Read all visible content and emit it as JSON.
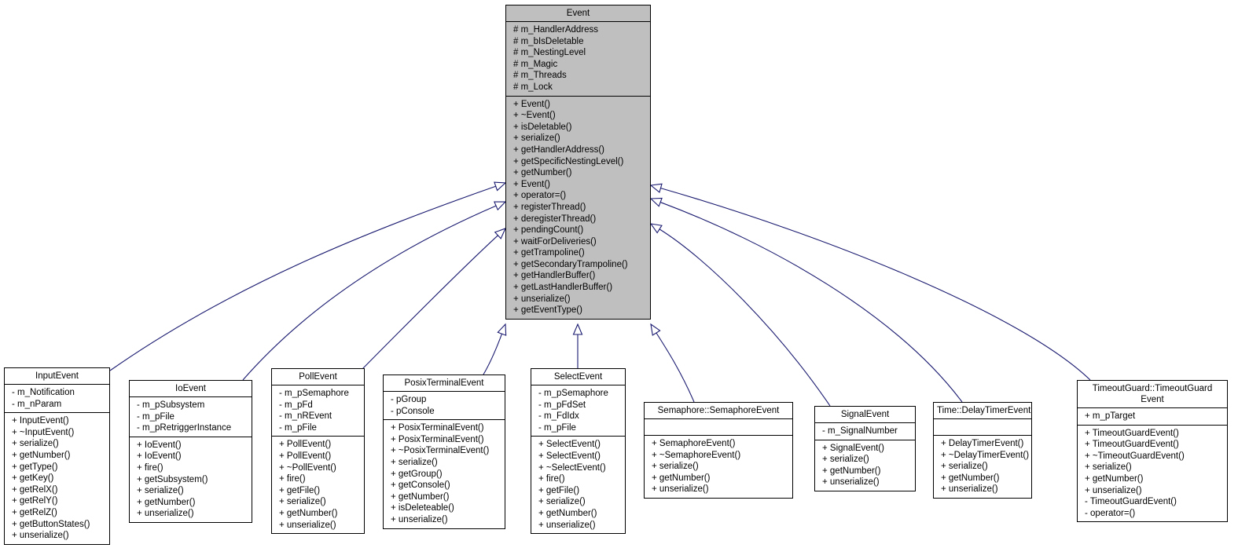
{
  "diagram": {
    "type": "UML class inheritance diagram",
    "edge_color": "#191970",
    "base_fill": "#bfbfbf",
    "base": {
      "id": "event",
      "name": "Event",
      "attributes": [
        "# m_HandlerAddress",
        "# m_bIsDeletable",
        "# m_NestingLevel",
        "# m_Magic",
        "# m_Threads",
        "# m_Lock"
      ],
      "methods": [
        "+ Event()",
        "+ ~Event()",
        "+ isDeletable()",
        "+ serialize()",
        "+ getHandlerAddress()",
        "+ getSpecificNestingLevel()",
        "+ getNumber()",
        "+ Event()",
        "+ operator=()",
        "+ registerThread()",
        "+ deregisterThread()",
        "+ pendingCount()",
        "+ waitForDeliveries()",
        "+ getTrampoline()",
        "+ getSecondaryTrampoline()",
        "+ getHandlerBuffer()",
        "+ getLastHandlerBuffer()",
        "+ unserialize()",
        "+ getEventType()"
      ]
    },
    "derived": [
      {
        "id": "input-event",
        "name": "InputEvent",
        "attributes": [
          "- m_Notification",
          "- m_nParam"
        ],
        "methods": [
          "+ InputEvent()",
          "+ ~InputEvent()",
          "+ serialize()",
          "+ getNumber()",
          "+ getType()",
          "+ getKey()",
          "+ getRelX()",
          "+ getRelY()",
          "+ getRelZ()",
          "+ getButtonStates()",
          "+ unserialize()"
        ]
      },
      {
        "id": "io-event",
        "name": "IoEvent",
        "attributes": [
          "- m_pSubsystem",
          "- m_pFile",
          "- m_pRetriggerInstance"
        ],
        "methods": [
          "+ IoEvent()",
          "+ IoEvent()",
          "+ fire()",
          "+ getSubsystem()",
          "+ serialize()",
          "+ getNumber()",
          "+ unserialize()"
        ]
      },
      {
        "id": "poll-event",
        "name": "PollEvent",
        "attributes": [
          "- m_pSemaphore",
          "- m_pFd",
          "- m_nREvent",
          "- m_pFile"
        ],
        "methods": [
          "+ PollEvent()",
          "+ PollEvent()",
          "+ ~PollEvent()",
          "+ fire()",
          "+ getFile()",
          "+ serialize()",
          "+ getNumber()",
          "+ unserialize()"
        ]
      },
      {
        "id": "posix-terminal-event",
        "name": "PosixTerminalEvent",
        "attributes": [
          "- pGroup",
          "- pConsole"
        ],
        "methods": [
          "+ PosixTerminalEvent()",
          "+ PosixTerminalEvent()",
          "+ ~PosixTerminalEvent()",
          "+ serialize()",
          "+ getGroup()",
          "+ getConsole()",
          "+ getNumber()",
          "+ isDeleteable()",
          "+ unserialize()"
        ]
      },
      {
        "id": "select-event",
        "name": "SelectEvent",
        "attributes": [
          "- m_pSemaphore",
          "- m_pFdSet",
          "- m_FdIdx",
          "- m_pFile"
        ],
        "methods": [
          "+ SelectEvent()",
          "+ SelectEvent()",
          "+ ~SelectEvent()",
          "+ fire()",
          "+ getFile()",
          "+ serialize()",
          "+ getNumber()",
          "+ unserialize()"
        ]
      },
      {
        "id": "semaphore-event",
        "name": "Semaphore::SemaphoreEvent",
        "attributes": [],
        "methods": [
          "+ SemaphoreEvent()",
          "+ ~SemaphoreEvent()",
          "+ serialize()",
          "+ getNumber()",
          "+ unserialize()"
        ]
      },
      {
        "id": "signal-event",
        "name": "SignalEvent",
        "attributes": [
          "- m_SignalNumber"
        ],
        "methods": [
          "+ SignalEvent()",
          "+ serialize()",
          "+ getNumber()",
          "+ unserialize()"
        ]
      },
      {
        "id": "delay-timer-event",
        "name": "Time::DelayTimerEvent",
        "attributes": [],
        "methods": [
          "+ DelayTimerEvent()",
          "+ ~DelayTimerEvent()",
          "+ serialize()",
          "+ getNumber()",
          "+ unserialize()"
        ]
      },
      {
        "id": "timeout-guard-event",
        "name": "TimeoutGuard::TimeoutGuard\nEvent",
        "attributes": [
          "+ m_pTarget"
        ],
        "methods": [
          "+ TimeoutGuardEvent()",
          "+ TimeoutGuardEvent()",
          "+ ~TimeoutGuardEvent()",
          "+ serialize()",
          "+ getNumber()",
          "+ unserialize()",
          "- TimeoutGuardEvent()",
          "- operator=()"
        ]
      }
    ]
  }
}
